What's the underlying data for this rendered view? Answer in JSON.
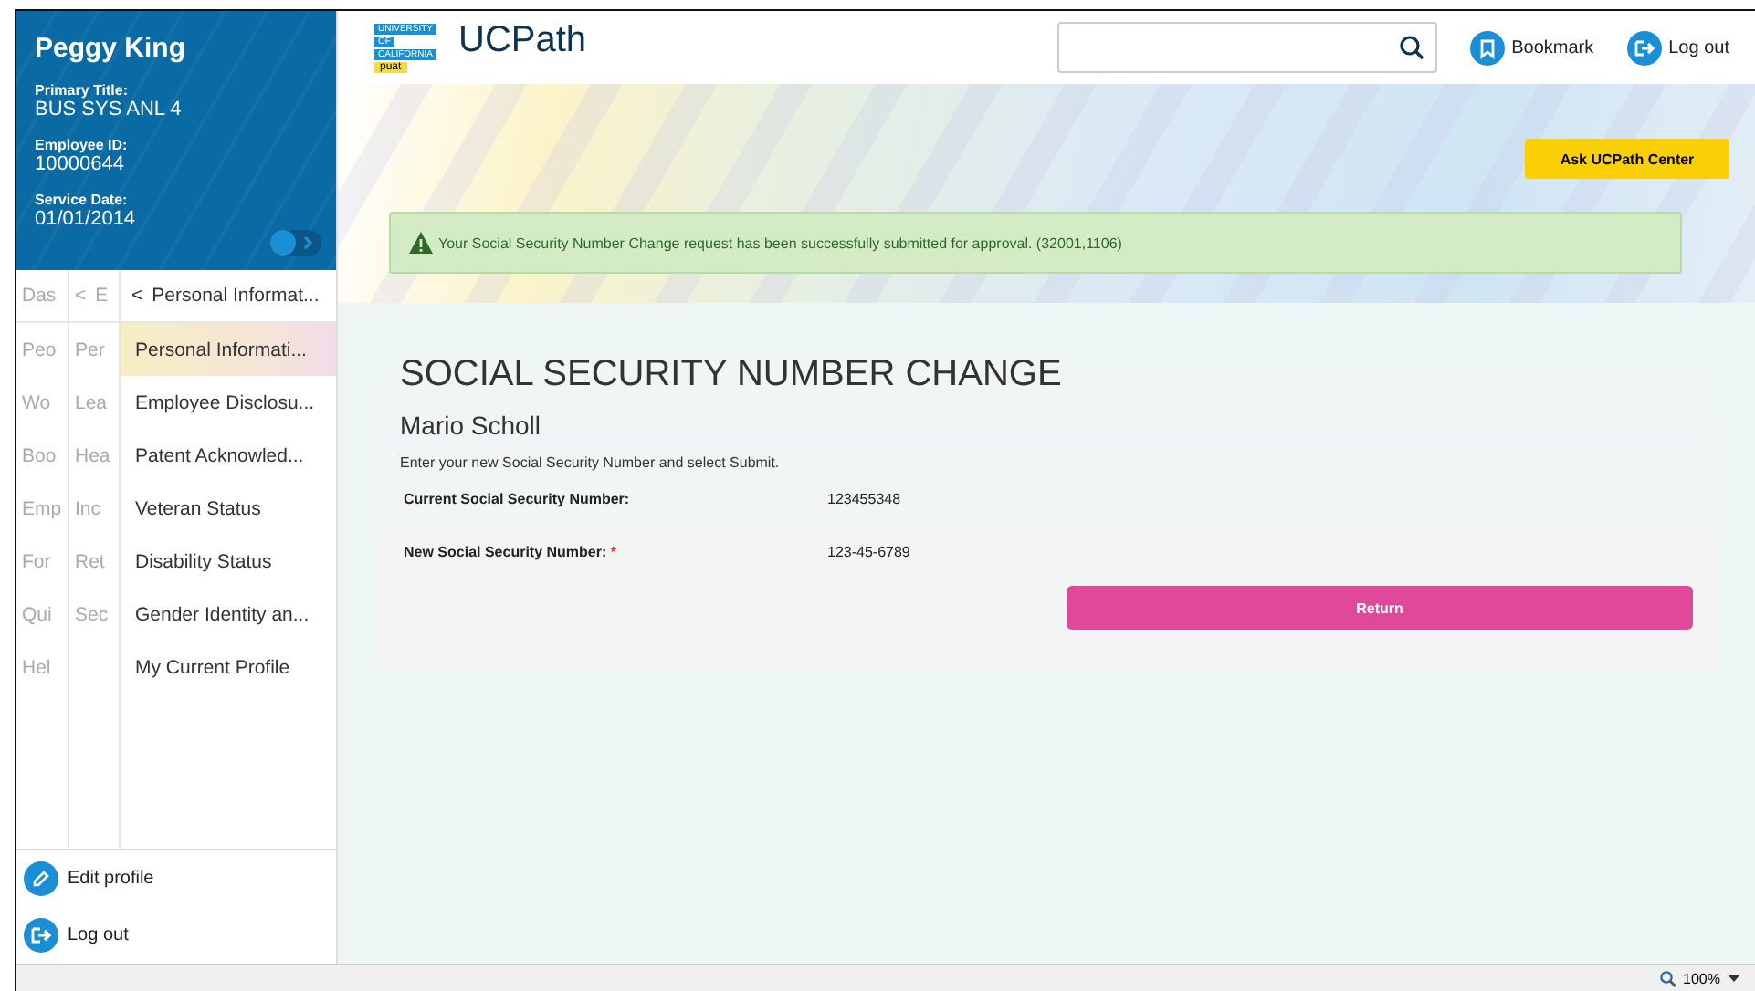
{
  "profile": {
    "name": "Peggy King",
    "fields": [
      {
        "label": "Primary Title:",
        "value": "BUS SYS ANL 4"
      },
      {
        "label": "Employee ID:",
        "value": "10000644"
      },
      {
        "label": "Service Date:",
        "value": "01/01/2014"
      }
    ],
    "toggle_on": false
  },
  "nav": {
    "column_1": {
      "header": "Das",
      "items": [
        "Peo",
        "Wo",
        "Boo",
        "Emp",
        "For",
        "Qui",
        "Hel"
      ]
    },
    "column_2": {
      "header_back": "<",
      "header": "E",
      "items": [
        "Per",
        "Lea",
        "Hea",
        "Inc",
        "Ret",
        "Sec"
      ]
    },
    "column_3": {
      "header_back": "<",
      "header": "Personal Informat...",
      "items": [
        {
          "label": "Personal Informati...",
          "selected": true
        },
        {
          "label": "Employee Disclosu...",
          "selected": false
        },
        {
          "label": "Patent Acknowled...",
          "selected": false
        },
        {
          "label": "Veteran Status",
          "selected": false
        },
        {
          "label": "Disability Status",
          "selected": false
        },
        {
          "label": "Gender Identity an...",
          "selected": false
        },
        {
          "label": "My Current Profile",
          "selected": false
        }
      ]
    }
  },
  "sidebar_footer": [
    {
      "kind": "edit",
      "label": "Edit profile"
    },
    {
      "kind": "logout",
      "label": "Log out"
    }
  ],
  "header": {
    "logo_lines": [
      "UNIVERSITY",
      "OF",
      "CALIFORNIA"
    ],
    "env_badge": "puat",
    "app_name": "UCPath",
    "actions": [
      {
        "kind": "bookmark",
        "label": "Bookmark"
      },
      {
        "kind": "logout",
        "label": "Log out"
      }
    ]
  },
  "ask_button": "Ask UCPath Center",
  "message": "Your Social Security Number Change request has been successfully submitted for approval. (32001,1106)",
  "form": {
    "title": "SOCIAL SECURITY NUMBER CHANGE",
    "person": "Mario Scholl",
    "instruction": "Enter your new Social Security Number and select Submit.",
    "rows": [
      {
        "label": "Current Social Security Number:",
        "value": "123455348"
      },
      {
        "label": "New Social Security Number:",
        "required_mark": "*",
        "value": "123-45-6789"
      }
    ],
    "button": "Return"
  },
  "status_bar": {
    "zoom": "100%"
  }
}
